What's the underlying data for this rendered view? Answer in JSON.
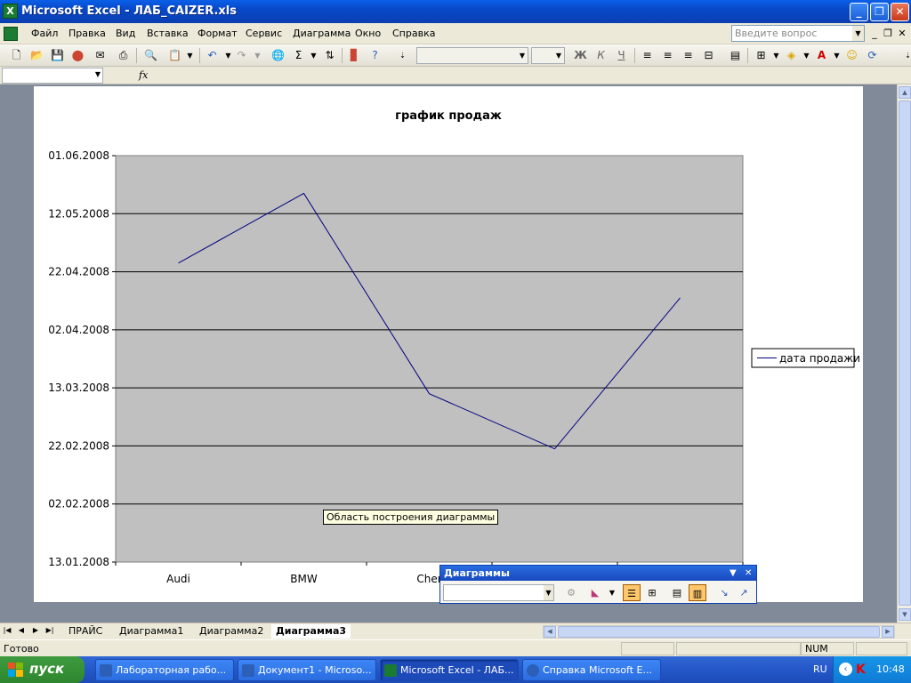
{
  "window": {
    "title": "Microsoft Excel - ЛАБ_CAIZER.xls",
    "controls": [
      "minimize",
      "maximize",
      "close"
    ]
  },
  "menu": {
    "items": [
      "Файл",
      "Правка",
      "Вид",
      "Вставка",
      "Формат",
      "Сервис",
      "Диаграмма",
      "Окно",
      "Справка"
    ],
    "help_placeholder": "Введите вопрос"
  },
  "toolbar": {
    "font_name": "",
    "font_size": "",
    "bold": "Ж",
    "italic": "К",
    "underline": "Ч",
    "autosum": "Σ"
  },
  "formula_bar": {
    "name_box": "",
    "fx_label": "fx",
    "formula": ""
  },
  "chart_data": {
    "type": "line",
    "title": "график продаж",
    "categories": [
      "Audi",
      "BMW",
      "Cher",
      "",
      ""
    ],
    "series": [
      {
        "name": "дата продажи",
        "color": "#000080",
        "values": [
          "2008-04-25",
          "2008-05-19",
          "2008-03-11",
          "2008-02-21",
          "2008-04-13"
        ]
      }
    ],
    "y_ticks": [
      "01.06.2008",
      "12.05.2008",
      "22.04.2008",
      "02.04.2008",
      "13.03.2008",
      "22.02.2008",
      "02.02.2008",
      "13.01.2008"
    ],
    "ylim": [
      "2008-01-13",
      "2008-06-01"
    ],
    "grid": true,
    "plot_background": "#c0c0c0",
    "legend_position": "right"
  },
  "tooltip": "Область построения диаграммы",
  "chart_toolbar": {
    "title": "Диаграммы",
    "object_selector": ""
  },
  "sheet_tabs": {
    "tabs": [
      "ПРАЙС",
      "Диаграмма1",
      "Диаграмма2",
      "Диаграмма3"
    ],
    "active": "Диаграмма3"
  },
  "status": {
    "text": "Готово",
    "num": "NUM"
  },
  "taskbar": {
    "start_label": "пуск",
    "tasks": [
      {
        "label": "Лабораторная рабо...",
        "icon_color": "#2b5fb8",
        "icon": "word-icon"
      },
      {
        "label": "Документ1 - Microso...",
        "icon_color": "#2b5fb8",
        "icon": "word-icon"
      },
      {
        "label": "Microsoft Excel - ЛАБ...",
        "icon_color": "#1b7b32",
        "icon": "excel-icon"
      },
      {
        "label": "Справка Microsoft E...",
        "icon_color": "#2b5fb8",
        "icon": "help-icon"
      }
    ],
    "language": "RU",
    "clock": "10:48"
  }
}
